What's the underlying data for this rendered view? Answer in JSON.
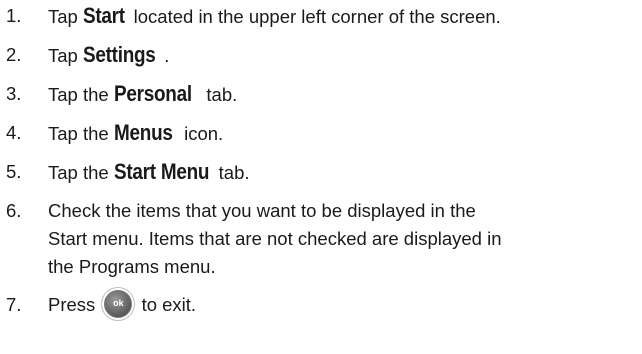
{
  "steps": [
    {
      "num": "1.",
      "pre": "Tap ",
      "kw": "Start",
      "post": " located in the upper left corner of the screen."
    },
    {
      "num": "2.",
      "pre": "Tap ",
      "kw": "Settings",
      "post": "."
    },
    {
      "num": "3.",
      "pre": "Tap the ",
      "kw": "Personal",
      "post": " tab."
    },
    {
      "num": "4.",
      "pre": "Tap the ",
      "kw": "Menus",
      "post": " icon."
    },
    {
      "num": "5.",
      "pre": "Tap the ",
      "kw": "Start Menu",
      "post": " tab."
    },
    {
      "num": "6.",
      "lines": [
        "Check the items that you want to be displayed in the",
        "Start menu. Items that are not checked are displayed in",
        "the Programs menu."
      ]
    },
    {
      "num": "7.",
      "pre": "Press ",
      "button_label": "ok",
      "post": " to exit."
    }
  ]
}
